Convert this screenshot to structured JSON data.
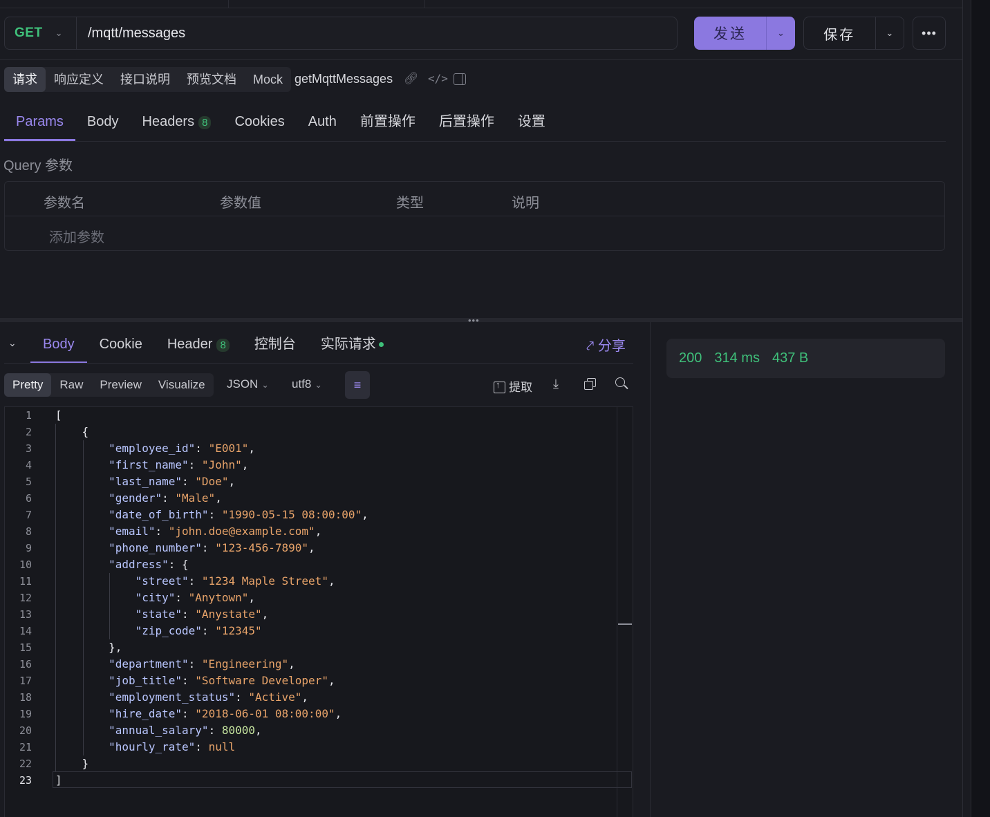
{
  "request": {
    "method": "GET",
    "url": "/mqtt/messages",
    "send_label": "发送",
    "save_label": "保存",
    "more_label": "•••"
  },
  "request_tabs": [
    {
      "label": "请求",
      "active": true
    },
    {
      "label": "响应定义"
    },
    {
      "label": "接口说明"
    },
    {
      "label": "预览文档"
    },
    {
      "label": "Mock"
    }
  ],
  "api_name": "getMqttMessages",
  "param_tabs": [
    {
      "label": "Params",
      "active": true
    },
    {
      "label": "Body"
    },
    {
      "label": "Headers",
      "badge": "8"
    },
    {
      "label": "Cookies"
    },
    {
      "label": "Auth"
    },
    {
      "label": "前置操作"
    },
    {
      "label": "后置操作"
    },
    {
      "label": "设置"
    }
  ],
  "query": {
    "title": "Query 参数",
    "columns": [
      "参数名",
      "参数值",
      "类型",
      "说明"
    ],
    "add_placeholder": "添加参数"
  },
  "response_tabs": [
    {
      "label": "Body",
      "active": true
    },
    {
      "label": "Cookie"
    },
    {
      "label": "Header",
      "badge": "8"
    },
    {
      "label": "控制台"
    },
    {
      "label": "实际请求",
      "dot": true
    }
  ],
  "share_label": "分享",
  "format_tabs": [
    {
      "label": "Pretty",
      "active": true
    },
    {
      "label": "Raw"
    },
    {
      "label": "Preview"
    },
    {
      "label": "Visualize"
    }
  ],
  "format_select": "JSON",
  "encoding_select": "utf8",
  "extract_label": "提取",
  "status": {
    "code": "200",
    "time": "314 ms",
    "size": "437 B"
  },
  "code_lines": [
    "[",
    "    {",
    "        \"employee_id\": \"E001\",",
    "        \"first_name\": \"John\",",
    "        \"last_name\": \"Doe\",",
    "        \"gender\": \"Male\",",
    "        \"date_of_birth\": \"1990-05-15 08:00:00\",",
    "        \"email\": \"john.doe@example.com\",",
    "        \"phone_number\": \"123-456-7890\",",
    "        \"address\": {",
    "            \"street\": \"1234 Maple Street\",",
    "            \"city\": \"Anytown\",",
    "            \"state\": \"Anystate\",",
    "            \"zip_code\": \"12345\"",
    "        },",
    "        \"department\": \"Engineering\",",
    "        \"job_title\": \"Software Developer\",",
    "        \"employment_status\": \"Active\",",
    "        \"hire_date\": \"2018-06-01 08:00:00\",",
    "        \"annual_salary\": 80000,",
    "        \"hourly_rate\": null",
    "    }",
    "]"
  ],
  "current_line": 23
}
